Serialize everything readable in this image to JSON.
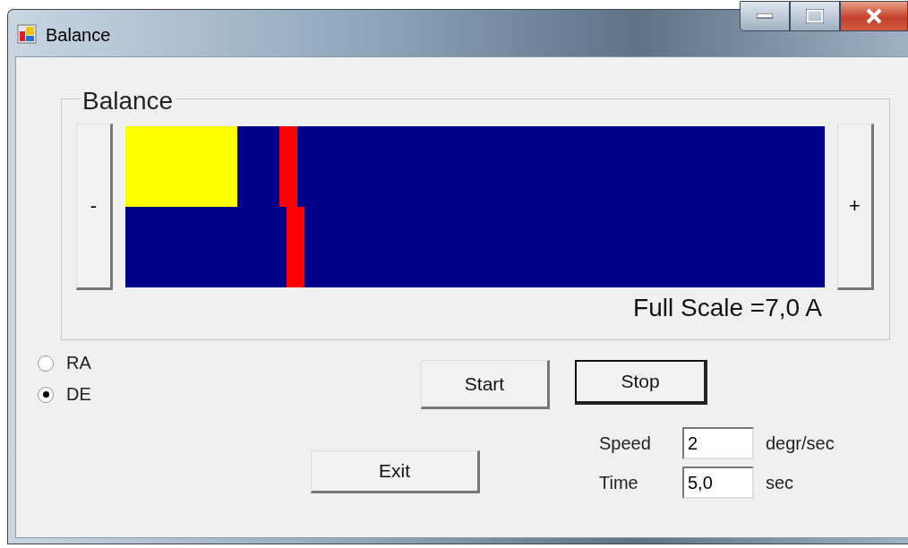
{
  "window": {
    "title": "Balance"
  },
  "group": {
    "title": "Balance",
    "minus": "-",
    "plus": "+",
    "full_scale": "Full Scale =7,0 A",
    "fill": {
      "level": 0.16
    },
    "markers": [
      {
        "level": 0.22
      },
      {
        "level": 0.23
      }
    ]
  },
  "axes": [
    {
      "label": "RA",
      "selected": false
    },
    {
      "label": "DE",
      "selected": true
    }
  ],
  "buttons": {
    "start": "Start",
    "stop": "Stop",
    "exit": "Exit"
  },
  "fields": [
    {
      "label": "Speed",
      "value": "2",
      "unit": "degr/sec"
    },
    {
      "label": "Time",
      "value": "5,0",
      "unit": "sec"
    }
  ]
}
